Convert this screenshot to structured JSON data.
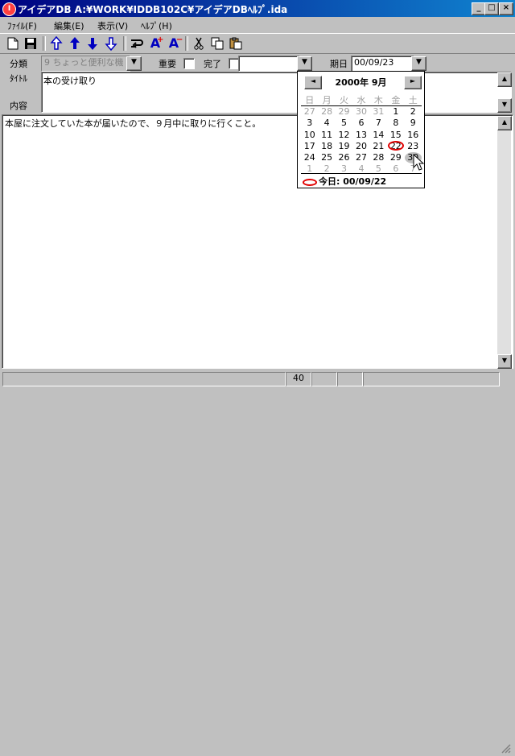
{
  "window": {
    "title": "アイデアDB  A:¥WORK¥IDDB102C¥アイデアDBﾍﾙﾌﾟ.ida",
    "minimize": "_",
    "maximize": "□",
    "close": "×"
  },
  "menu": [
    {
      "label": "ﾌｧｲﾙ(F)"
    },
    {
      "label": "編集(E)"
    },
    {
      "label": "表示(V)"
    },
    {
      "label": "ﾍﾙﾌﾟ(H)"
    }
  ],
  "toolbar_icons": [
    "new-file-icon",
    "save-icon",
    "move-top-icon",
    "move-up-icon",
    "move-down-icon",
    "move-bottom-icon",
    "wrap-icon",
    "font-larger-icon",
    "font-smaller-icon",
    "cut-icon",
    "copy-icon",
    "paste-icon"
  ],
  "fields": {
    "category_label": "分類",
    "category_value": "9 ちょっと便利な機",
    "important_label": "重要",
    "done_label": "完了",
    "done_value": "",
    "due_label": "期日",
    "due_value": "00/09/23",
    "title_label": "ﾀｲﾄﾙ",
    "title_value": "本の受け取り",
    "content_label": "内容"
  },
  "content_text": "本屋に注文していた本が届いたので、９月中に取りに行くこと。",
  "calendar": {
    "month_label": "2000年 9月",
    "prev": "◄",
    "next": "►",
    "weekdays": [
      "日",
      "月",
      "火",
      "水",
      "木",
      "金",
      "土"
    ],
    "weeks": [
      [
        "27",
        "28",
        "29",
        "30",
        "31",
        "1",
        "2"
      ],
      [
        "3",
        "4",
        "5",
        "6",
        "7",
        "8",
        "9"
      ],
      [
        "10",
        "11",
        "12",
        "13",
        "14",
        "15",
        "16"
      ],
      [
        "17",
        "18",
        "19",
        "20",
        "21",
        "22",
        "23"
      ],
      [
        "24",
        "25",
        "26",
        "27",
        "28",
        "29",
        "30"
      ],
      [
        "1",
        "2",
        "3",
        "4",
        "5",
        "6",
        "7"
      ]
    ],
    "today_text": "今日: 00/09/22",
    "today_color": "#e00000"
  },
  "status": {
    "line": "40"
  }
}
